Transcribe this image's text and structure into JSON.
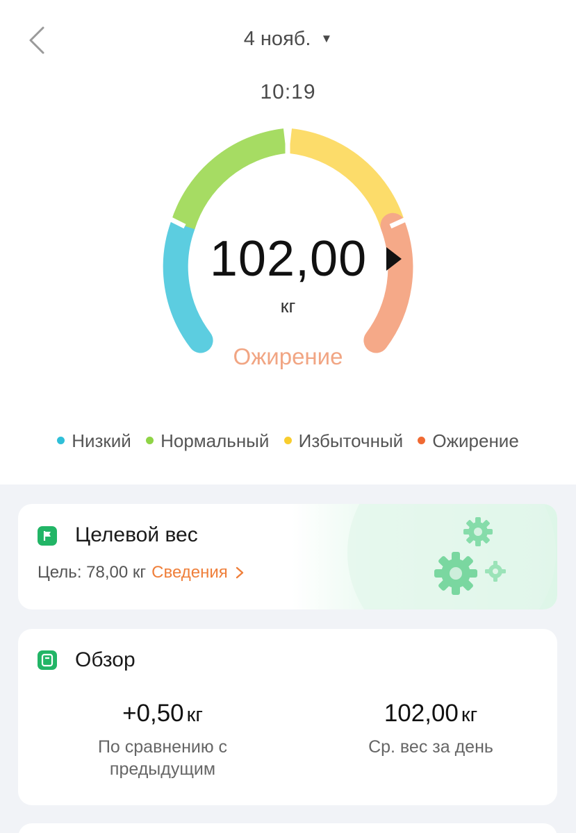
{
  "header": {
    "date": "4 нояб.",
    "time": "10:19"
  },
  "gauge": {
    "value": "102,00",
    "unit": "кг",
    "category": "Ожирение",
    "segments": [
      {
        "name": "Низкий",
        "color": "#5ccde0"
      },
      {
        "name": "Нормальный",
        "color": "#a6dc63"
      },
      {
        "name": "Избыточный",
        "color": "#fcdc6a"
      },
      {
        "name": "Ожирение",
        "color": "#f5a988"
      }
    ]
  },
  "legend": {
    "items": [
      {
        "label": "Низкий",
        "color": "#2fbfd8"
      },
      {
        "label": "Нормальный",
        "color": "#8fd446"
      },
      {
        "label": "Избыточный",
        "color": "#f8cd2e"
      },
      {
        "label": "Ожирение",
        "color": "#f06a33"
      }
    ]
  },
  "goal_card": {
    "title": "Целевой вес",
    "goal_text": "Цель: 78,00 кг",
    "details_link": "Сведения",
    "icon": "flag-icon"
  },
  "overview_card": {
    "title": "Обзор",
    "icon": "scale-icon",
    "stats": [
      {
        "value": "+0,50",
        "unit": "кг",
        "label_line1": "По сравнению с",
        "label_line2": "предыдущим"
      },
      {
        "value": "102,00",
        "unit": "кг",
        "label_line1": "Ср. вес за день",
        "label_line2": ""
      }
    ]
  },
  "colors": {
    "accent_orange": "#ef7f3a",
    "brand_green": "#22b566"
  }
}
